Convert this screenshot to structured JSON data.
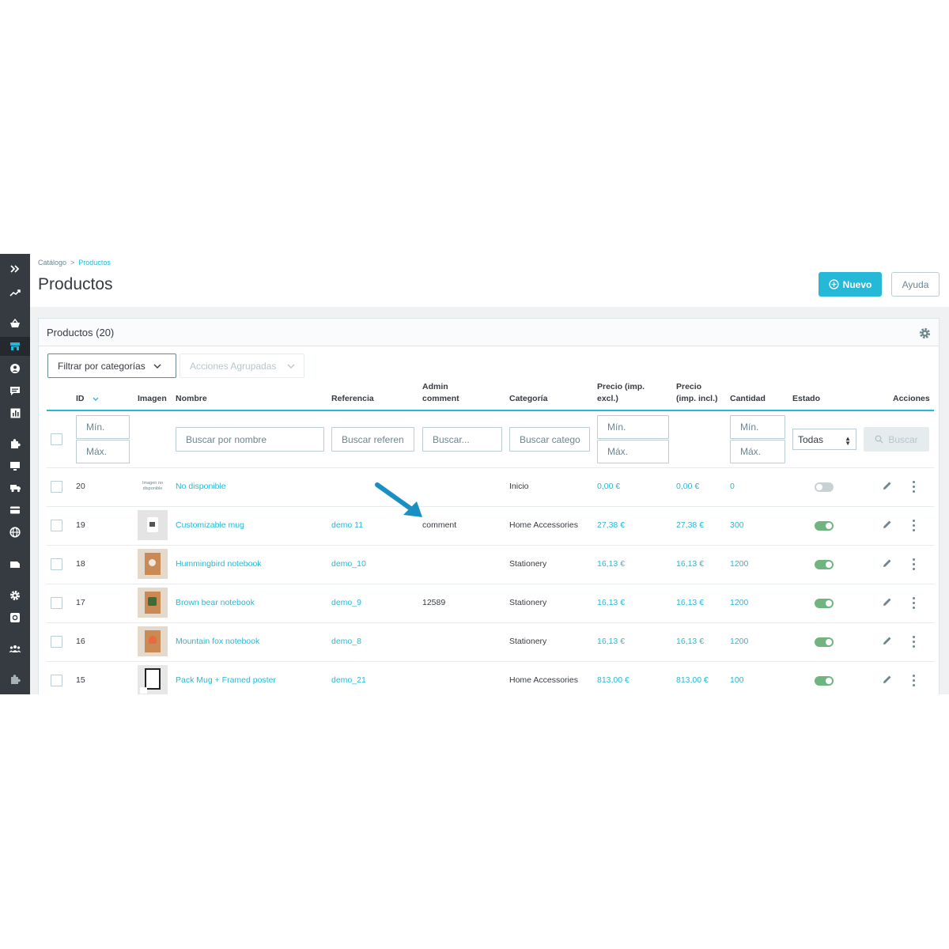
{
  "breadcrumb": {
    "parent": "Catálogo",
    "separator": ">",
    "current": "Productos"
  },
  "page_title": "Productos",
  "toolbar": {
    "new_label": "Nuevo",
    "help_label": "Ayuda"
  },
  "card": {
    "title": "Productos (20)"
  },
  "filters": {
    "category_button": "Filtrar por categorías",
    "bulk_actions": "Acciones Agrupadas"
  },
  "columns": {
    "id": "ID",
    "image": "Imagen",
    "name": "Nombre",
    "reference": "Referencia",
    "admin_comment_1": "Admin",
    "admin_comment_2": "comment",
    "category": "Categoría",
    "price_excl_1": "Precio (imp.",
    "price_excl_2": "excl.)",
    "price_incl_1": "Precio",
    "price_incl_2": "(imp. incl.)",
    "quantity": "Cantidad",
    "status": "Estado",
    "actions": "Acciones"
  },
  "filter_row": {
    "id_min": "Mín.",
    "id_max": "Máx.",
    "name": "Buscar por nombre",
    "reference": "Buscar referen",
    "comment": "Buscar...",
    "category": "Buscar catego",
    "price_min": "Mín.",
    "price_max": "Máx.",
    "qty_min": "Mín.",
    "qty_max": "Máx.",
    "status_select": "Todas",
    "search_button": "Buscar"
  },
  "no_image_text": "Imagen no disponible",
  "products": [
    {
      "id": "20",
      "name": "No disponible",
      "reference": "",
      "comment": "",
      "category": "Inicio",
      "price_excl": "0,00 €",
      "price_incl": "0,00 €",
      "quantity": "0",
      "active": false
    },
    {
      "id": "19",
      "name": "Customizable mug",
      "reference": "demo 11",
      "comment": "comment",
      "category": "Home Accessories",
      "price_excl": "27,38 €",
      "price_incl": "27,38 €",
      "quantity": "300",
      "active": true
    },
    {
      "id": "18",
      "name": "Hummingbird notebook",
      "reference": "demo_10",
      "comment": "",
      "category": "Stationery",
      "price_excl": "16,13 €",
      "price_incl": "16,13 €",
      "quantity": "1200",
      "active": true
    },
    {
      "id": "17",
      "name": "Brown bear notebook",
      "reference": "demo_9",
      "comment": "12589",
      "category": "Stationery",
      "price_excl": "16,13 €",
      "price_incl": "16,13 €",
      "quantity": "1200",
      "active": true
    },
    {
      "id": "16",
      "name": "Mountain fox notebook",
      "reference": "demo_8",
      "comment": "",
      "category": "Stationery",
      "price_excl": "16,13 €",
      "price_incl": "16,13 €",
      "quantity": "1200",
      "active": true
    },
    {
      "id": "15",
      "name": "Pack Mug + Framed poster",
      "reference": "demo_21",
      "comment": "",
      "category": "Home Accessories",
      "price_excl": "813,00 €",
      "price_incl": "813,00 €",
      "quantity": "100",
      "active": true
    }
  ],
  "colors": {
    "accent": "#25b9d7",
    "sidebar": "#363a41",
    "toggle_on": "#70b580",
    "arrow": "#1a8fc4"
  }
}
